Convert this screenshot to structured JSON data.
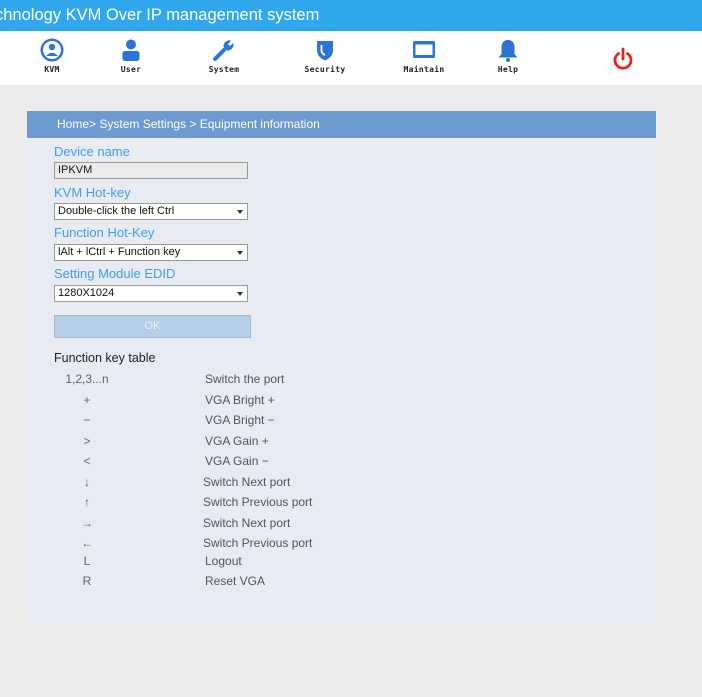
{
  "window": {
    "title": "chnology KVM Over IP management system"
  },
  "nav": {
    "items": [
      {
        "label": "KVM",
        "icon": "kvm-icon"
      },
      {
        "label": "User",
        "icon": "user-icon"
      },
      {
        "label": "System",
        "icon": "wrench-icon"
      },
      {
        "label": "Security",
        "icon": "shield-icon"
      },
      {
        "label": "Maintain",
        "icon": "monitor-icon"
      },
      {
        "label": "Help",
        "icon": "bell-icon"
      }
    ],
    "power_icon": "power-icon"
  },
  "breadcrumb": "Home> System Settings > Equipment information",
  "form": {
    "device_name_label": "Device name",
    "device_name_value": "IPKVM",
    "kvm_hotkey_label": "KVM Hot-key",
    "kvm_hotkey_value": "Double-click the left Ctrl",
    "function_hotkey_label": "Function Hot-Key",
    "function_hotkey_value": "lAlt + lCtrl + Function key",
    "edid_label": "Setting Module EDID",
    "edid_value": "1280X1024",
    "ok_label": "OK"
  },
  "function_keys": {
    "title": "Function key table",
    "rows": [
      {
        "key": "1,2,3...n",
        "desc": "Switch the port"
      },
      {
        "key": "+",
        "desc": "VGA Bright +"
      },
      {
        "key": "−",
        "desc": "VGA Bright −"
      },
      {
        "key": ">",
        "desc": "VGA Gain +"
      },
      {
        "key": "<",
        "desc": "VGA Gain −"
      },
      {
        "key": "↓",
        "desc": "Switch Next port"
      },
      {
        "key": "↑",
        "desc": "Switch Previous port"
      },
      {
        "key": "→",
        "desc": "Switch Next port"
      },
      {
        "key": "←",
        "desc": "Switch Previous port"
      },
      {
        "key": "L",
        "desc": "Logout"
      },
      {
        "key": "R",
        "desc": "Reset VGA"
      }
    ]
  },
  "colors": {
    "title_bar": "#31a8ee",
    "nav_icon": "#2d74d8",
    "power": "#e3261b",
    "panel_header": "#6d9ad0",
    "field_label": "#3d9fe8",
    "panel_bg": "#e9ebf3"
  }
}
